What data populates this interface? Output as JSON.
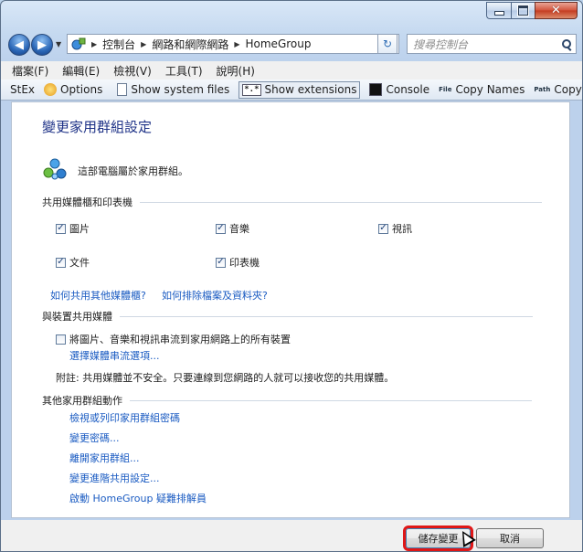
{
  "window": {
    "caption_buttons": [
      "minimize",
      "maximize",
      "close"
    ]
  },
  "nav": {
    "breadcrumbs": [
      "控制台",
      "網路和網際網路",
      "HomeGroup"
    ],
    "search_placeholder": "搜尋控制台"
  },
  "menubar": {
    "items": [
      "檔案(F)",
      "編輯(E)",
      "檢視(V)",
      "工具(T)",
      "說明(H)"
    ]
  },
  "toolbar": {
    "stex": "StEx",
    "options": "Options",
    "show_system_files": "Show system files",
    "show_extensions": "Show extensions",
    "console": "Console",
    "copy_names": "Copy Names",
    "copy_paths": "Copy Paths",
    "more": "»"
  },
  "content": {
    "title": "變更家用群組設定",
    "homegroup_status": "這部電腦屬於家用群組。",
    "section_libraries": "共用媒體櫃和印表機",
    "libraries": [
      {
        "label": "圖片",
        "checked": true
      },
      {
        "label": "音樂",
        "checked": true
      },
      {
        "label": "視訊",
        "checked": true
      },
      {
        "label": "文件",
        "checked": true
      },
      {
        "label": "印表機",
        "checked": true
      }
    ],
    "link_share_other": "如何共用其他媒體櫃?",
    "link_exclude": "如何排除檔案及資料夾?",
    "section_devices": "與裝置共用媒體",
    "stream_checkbox": {
      "label": "將圖片、音樂和視訊串流到家用網路上的所有裝置",
      "checked": false
    },
    "link_stream_options": "選擇媒體串流選項...",
    "note": "附註: 共用媒體並不安全。只要連線到您網路的人就可以接收您的共用媒體。",
    "section_other": "其他家用群組動作",
    "actions": [
      "檢視或列印家用群組密碼",
      "變更密碼...",
      "離開家用群組...",
      "變更進階共用設定...",
      "啟動 HomeGroup 疑難排解員"
    ]
  },
  "buttons": {
    "save": "儲存變更",
    "cancel": "取消"
  },
  "colors": {
    "link": "#1a5bc2",
    "title": "#1e3287",
    "highlight": "#e01717"
  }
}
